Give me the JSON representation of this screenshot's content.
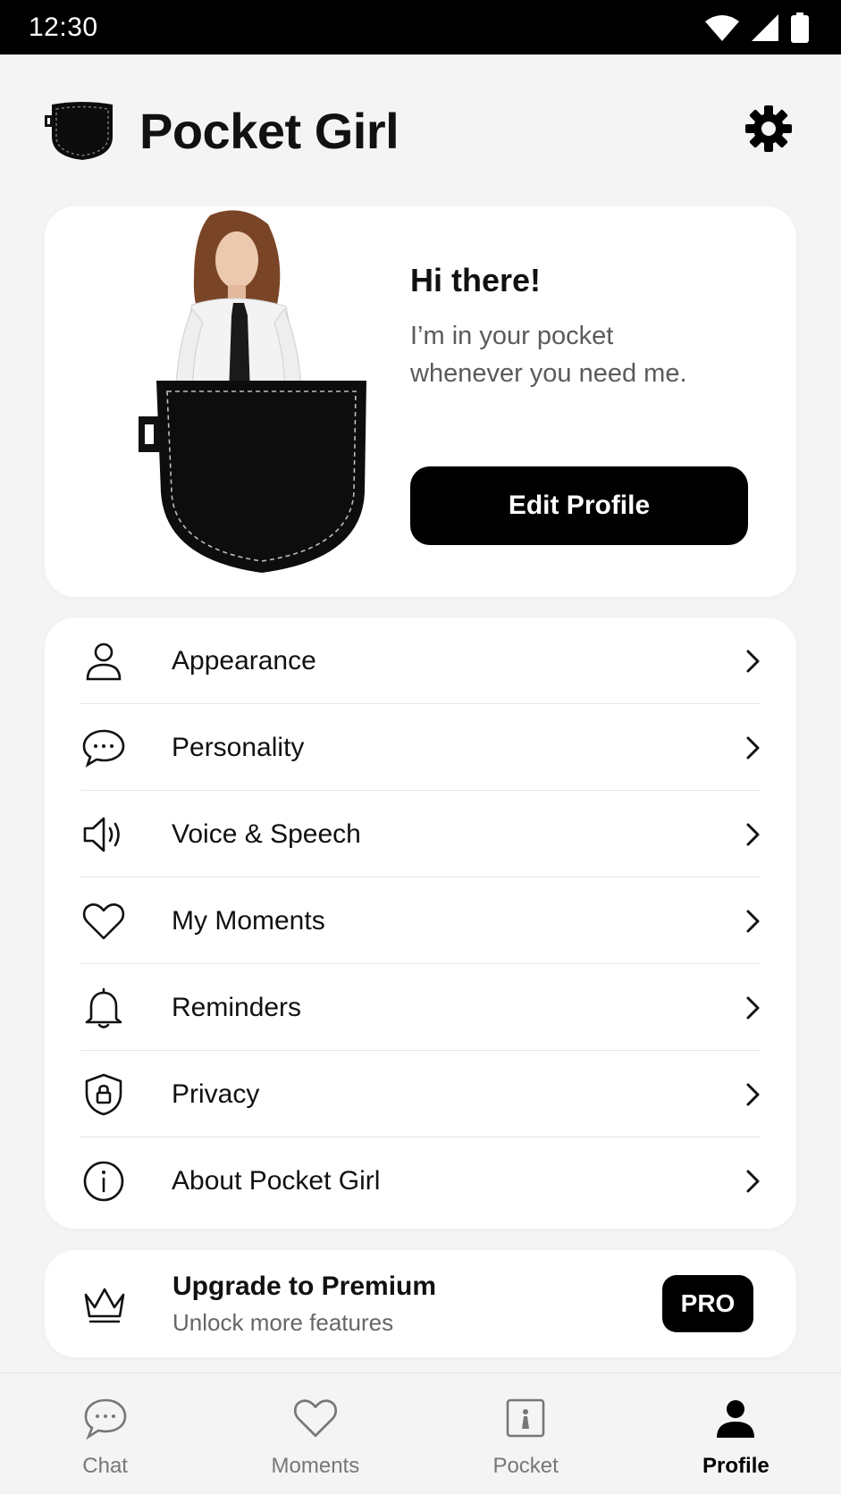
{
  "status_bar": {
    "time": "12:30"
  },
  "header": {
    "title": "Pocket Girl"
  },
  "hero": {
    "greeting": "Hi there!",
    "subtitle_line1": "I’m in your pocket",
    "subtitle_line2": "whenever you need me.",
    "edit_button": "Edit Profile"
  },
  "menu": {
    "items": [
      {
        "label": "Appearance",
        "icon": "person-icon"
      },
      {
        "label": "Personality",
        "icon": "chat-bubble-icon"
      },
      {
        "label": "Voice & Speech",
        "icon": "speaker-icon"
      },
      {
        "label": "My Moments",
        "icon": "heart-icon"
      },
      {
        "label": "Reminders",
        "icon": "bell-icon"
      },
      {
        "label": "Privacy",
        "icon": "shield-lock-icon"
      },
      {
        "label": "About Pocket Girl",
        "icon": "info-icon"
      }
    ]
  },
  "premium": {
    "title": "Upgrade to Premium",
    "subtitle": "Unlock more features",
    "badge": "PRO"
  },
  "bottom_nav": {
    "items": [
      {
        "label": "Chat",
        "icon": "chat-icon"
      },
      {
        "label": "Moments",
        "icon": "heart-icon"
      },
      {
        "label": "Pocket",
        "icon": "pocket-icon"
      },
      {
        "label": "Profile",
        "icon": "profile-icon",
        "active": true
      }
    ]
  },
  "colors": {
    "accent": "#000000",
    "background": "#f4f4f4",
    "card": "#ffffff",
    "muted_text": "#777777"
  }
}
